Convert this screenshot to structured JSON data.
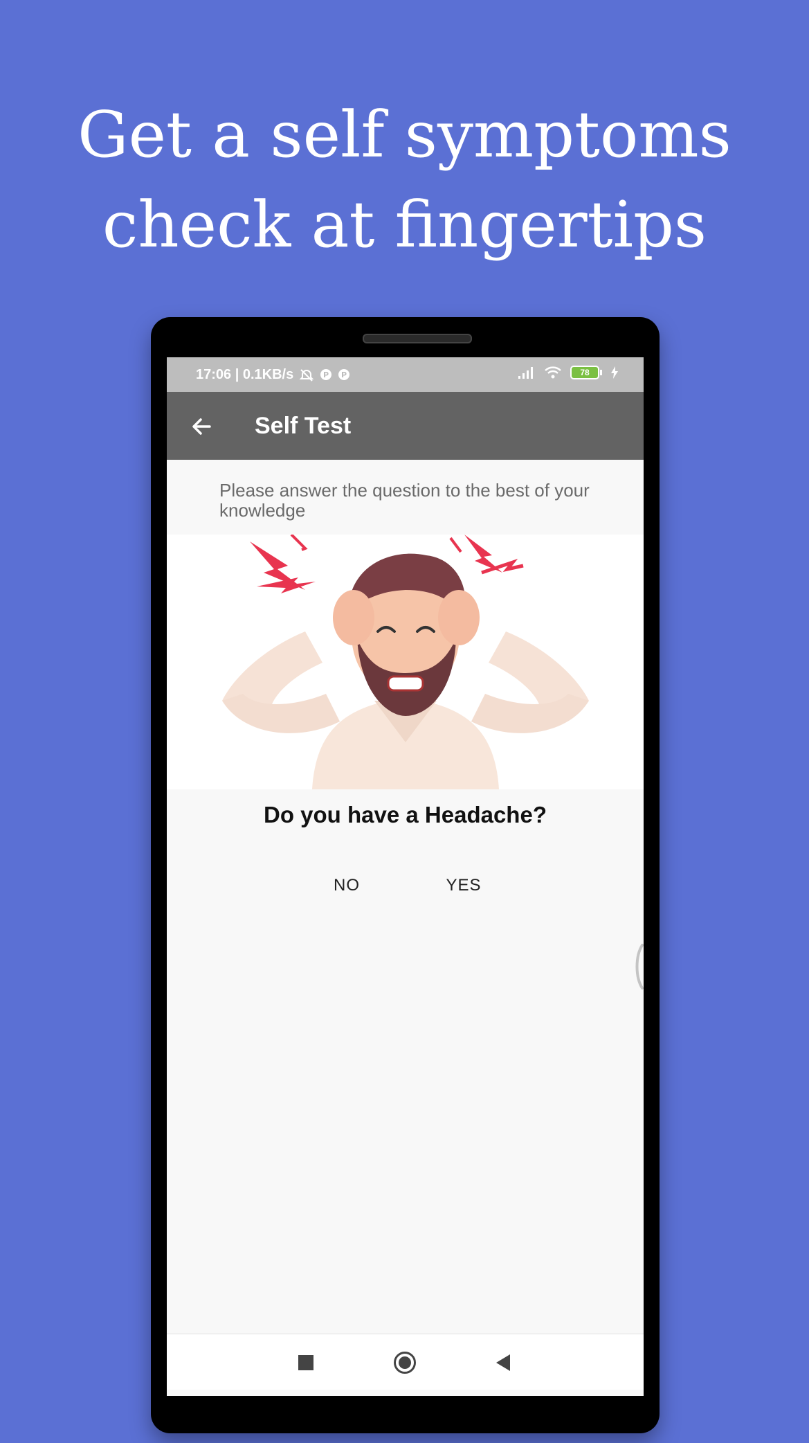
{
  "headline": {
    "line1": "Get a self symptoms",
    "line2": "check at fingertips"
  },
  "colors": {
    "background": "#5b70d4",
    "app_bar": "#636363",
    "status_bar": "#bdbdbd",
    "battery": "#7bc043"
  },
  "status_bar": {
    "time_and_speed": "17:06 | 0.1KB/s",
    "battery_level": "78",
    "icons": [
      "alarm-off-icon",
      "notification-p-icon",
      "notification-p-icon",
      "signal-icon",
      "wifi-icon",
      "battery-icon",
      "charging-icon"
    ]
  },
  "app_bar": {
    "title": "Self Test",
    "back_icon": "arrow-left-icon"
  },
  "instruction": "Please answer the question to the best of your knowledge",
  "question": {
    "text": "Do you have a Headache?",
    "illustration": "man-with-headache-illustration",
    "answers": {
      "no": "NO",
      "yes": "YES"
    }
  },
  "nav_bar": {
    "icons": [
      "recent-apps-icon",
      "home-icon",
      "back-triangle-icon"
    ]
  }
}
